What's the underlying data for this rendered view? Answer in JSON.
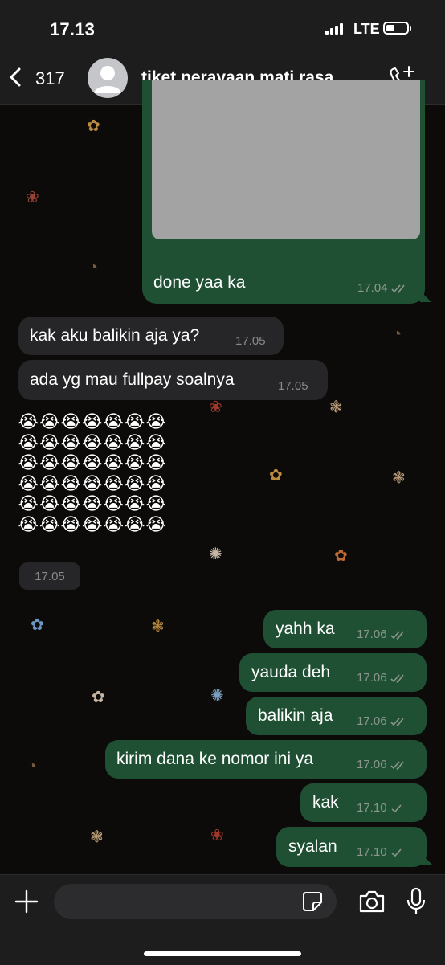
{
  "status_bar": {
    "time": "17.13",
    "network": "LTE"
  },
  "header": {
    "back_count": "317",
    "contact_name": "tiket perayaan mati rasa"
  },
  "messages": [
    {
      "direction": "out",
      "text": "done yaa ka",
      "time": "17.04",
      "status": "read",
      "has_image": true
    },
    {
      "direction": "in",
      "text": "kak aku balikin aja ya?",
      "time": "17.05"
    },
    {
      "direction": "in",
      "text": "ada yg mau fullpay soalnya",
      "time": "17.05"
    },
    {
      "direction": "in",
      "emoji": "😭",
      "emoji_count": 42,
      "time": "17.05"
    },
    {
      "direction": "out",
      "text": "yahh ka",
      "time": "17.06",
      "status": "read"
    },
    {
      "direction": "out",
      "text": "yauda deh",
      "time": "17.06",
      "status": "read"
    },
    {
      "direction": "out",
      "text": "balikin aja",
      "time": "17.06",
      "status": "read"
    },
    {
      "direction": "out",
      "text": "kirim dana ke nomor ini ya",
      "time": "17.06",
      "status": "read"
    },
    {
      "direction": "out",
      "text": "kak",
      "time": "17.10",
      "status": "sent"
    },
    {
      "direction": "out",
      "text": "syalan",
      "time": "17.10",
      "status": "sent"
    }
  ],
  "composer": {
    "placeholder": ""
  },
  "colors": {
    "outgoing": "#1f5033",
    "incoming": "#262628",
    "background": "#0c0b0a",
    "bars": "#1d1d1d"
  },
  "icons": [
    "chevron-left-icon",
    "avatar-icon",
    "phone-add-icon",
    "plus-icon",
    "sticker-icon",
    "camera-icon",
    "mic-icon",
    "double-check-icon",
    "single-check-icon"
  ]
}
